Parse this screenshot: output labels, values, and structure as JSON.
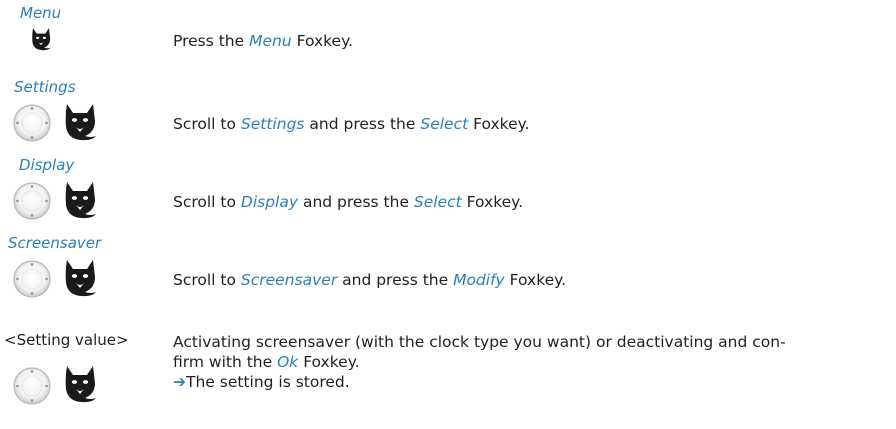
{
  "steps": [
    {
      "key_label": "Menu",
      "icons": [
        "foxkey-icon"
      ],
      "text": {
        "pre": "Press the ",
        "em1": "Menu",
        "mid": " Foxkey.",
        "em2": "",
        "post": ""
      }
    },
    {
      "key_label": "Settings",
      "icons": [
        "navigation-key-icon",
        "foxkey-icon"
      ],
      "text": {
        "pre": "Scroll to ",
        "em1": "Settings",
        "mid": " and press the ",
        "em2": "Select",
        "post": " Foxkey."
      }
    },
    {
      "key_label": "Display",
      "icons": [
        "navigation-key-icon",
        "foxkey-icon"
      ],
      "text": {
        "pre": "Scroll to ",
        "em1": "Display",
        "mid": " and press the ",
        "em2": "Select",
        "post": " Foxkey."
      }
    },
    {
      "key_label": "Screensaver",
      "icons": [
        "navigation-key-icon",
        "foxkey-icon"
      ],
      "text": {
        "pre": "Scroll to ",
        "em1": "Screensaver",
        "mid": " and press the ",
        "em2": "Modify",
        "post": " Foxkey."
      }
    },
    {
      "key_label": "<Setting value>",
      "icons": [
        "navigation-key-icon",
        "foxkey-icon"
      ],
      "text": {
        "line1": "Activating screensaver (with the clock type you want) or deactivating and con-",
        "line2_pre": "firm with the ",
        "line2_em": "Ok",
        "line2_post": " Foxkey.",
        "result_arrow": "➔",
        "result": "The setting is stored."
      }
    }
  ],
  "colors": {
    "accent": "#2b7fc0",
    "text": "#231f20"
  }
}
